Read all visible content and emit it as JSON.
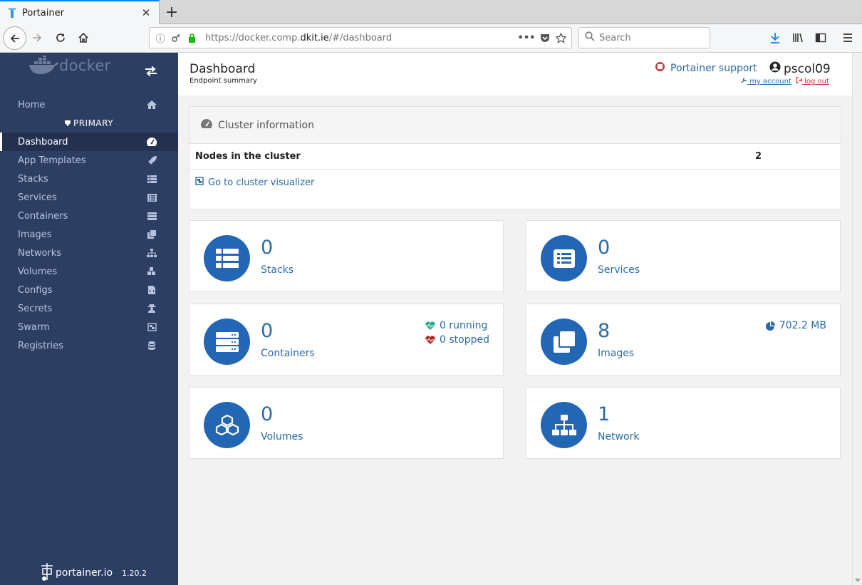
{
  "browser": {
    "tab_title": "Portainer",
    "url_prefix": "https://docker.comp.",
    "url_host": "dkit.ie",
    "url_path": "/#/dashboard",
    "search_placeholder": "Search"
  },
  "sidebar": {
    "brand": "docker",
    "home_label": "Home",
    "endpoint_label": "PRIMARY",
    "items": [
      {
        "label": "Dashboard",
        "icon": "tachometer-icon"
      },
      {
        "label": "App Templates",
        "icon": "rocket-icon"
      },
      {
        "label": "Stacks",
        "icon": "list-icon"
      },
      {
        "label": "Services",
        "icon": "list-alt-icon"
      },
      {
        "label": "Containers",
        "icon": "server-icon"
      },
      {
        "label": "Images",
        "icon": "clone-icon"
      },
      {
        "label": "Networks",
        "icon": "sitemap-icon"
      },
      {
        "label": "Volumes",
        "icon": "cubes-icon"
      },
      {
        "label": "Configs",
        "icon": "file-code-icon"
      },
      {
        "label": "Secrets",
        "icon": "user-secret-icon"
      },
      {
        "label": "Swarm",
        "icon": "object-group-icon"
      },
      {
        "label": "Registries",
        "icon": "database-icon"
      }
    ],
    "footer_brand": "portainer.io",
    "footer_version": "1.20.2"
  },
  "header": {
    "title": "Dashboard",
    "subtitle": "Endpoint summary",
    "support_label": "Portainer support",
    "username": "pscol09",
    "my_account_label": "my account",
    "logout_label": "log out"
  },
  "cluster": {
    "title": "Cluster information",
    "nodes_label": "Nodes in the cluster",
    "nodes_value": "2",
    "visualizer_label": "Go to cluster visualizer"
  },
  "widgets": {
    "stacks": {
      "count": "0",
      "label": "Stacks"
    },
    "services": {
      "count": "0",
      "label": "Services"
    },
    "containers": {
      "count": "0",
      "label": "Containers",
      "running": "0 running",
      "stopped": "0 stopped"
    },
    "images": {
      "count": "8",
      "label": "Images",
      "size": "702.2 MB"
    },
    "volumes": {
      "count": "0",
      "label": "Volumes"
    },
    "networks": {
      "count": "1",
      "label": "Network"
    }
  },
  "colors": {
    "sidebar_bg": "#2d3e63",
    "accent": "#2366b4",
    "link": "#2a6aa8",
    "running": "#23ae89",
    "stopped": "#ae2323"
  }
}
